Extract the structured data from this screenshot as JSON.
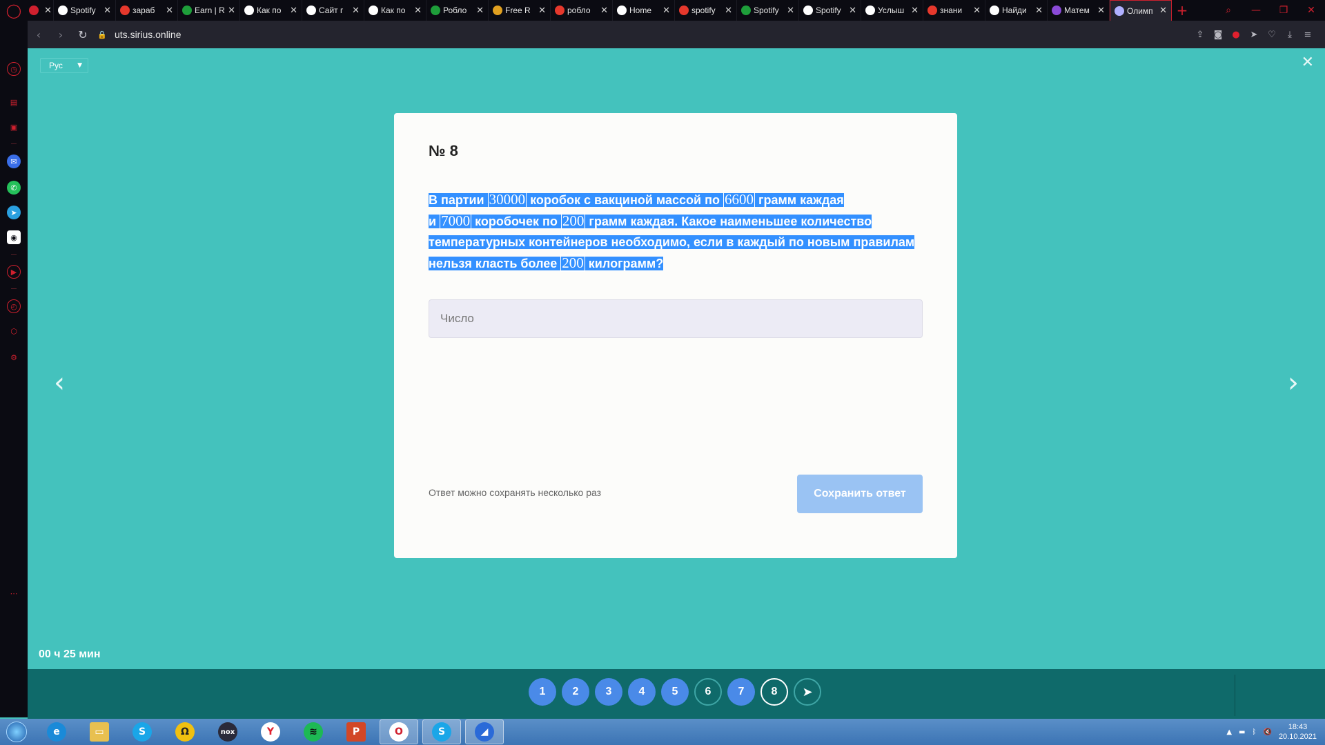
{
  "browser": {
    "tabs": [
      {
        "label": "",
        "favicon_color": "#d0202e",
        "favicon": "game-icon"
      },
      {
        "label": "Spotify",
        "favicon_color": "#ffffff",
        "favicon": "spotify-icon"
      },
      {
        "label": "зараб",
        "favicon_color": "#e6382c",
        "favicon": "yandex-icon"
      },
      {
        "label": "Earn | R",
        "favicon_color": "#1e9e3a",
        "favicon": "earn-icon"
      },
      {
        "label": "Как по",
        "favicon_color": "#ffffff",
        "favicon": "link-icon"
      },
      {
        "label": "Сайт г",
        "favicon_color": "#ffffff",
        "favicon": "site-icon"
      },
      {
        "label": "Как по",
        "favicon_color": "#ffffff",
        "favicon": "roblox-icon"
      },
      {
        "label": "Робло",
        "favicon_color": "#1e9e3a",
        "favicon": "rs-icon"
      },
      {
        "label": "Free R",
        "favicon_color": "#e0a020",
        "favicon": "free-icon"
      },
      {
        "label": "робло",
        "favicon_color": "#e6382c",
        "favicon": "yandex-icon"
      },
      {
        "label": "Home",
        "favicon_color": "#ffffff",
        "favicon": "home-icon"
      },
      {
        "label": "spotify",
        "favicon_color": "#e6382c",
        "favicon": "yandex-icon"
      },
      {
        "label": "Spotify",
        "favicon_color": "#1e9e3a",
        "favicon": "spotify-icon"
      },
      {
        "label": "Spotify",
        "favicon_color": "#ffffff",
        "favicon": "spotify-icon"
      },
      {
        "label": "Услыш",
        "favicon_color": "#ffffff",
        "favicon": "spotify-icon"
      },
      {
        "label": "знани",
        "favicon_color": "#e6382c",
        "favicon": "yandex-icon"
      },
      {
        "label": "Найди",
        "favicon_color": "#ffffff",
        "favicon": "z-icon"
      },
      {
        "label": "Матем",
        "favicon_color": "#8a4ad8",
        "favicon": "math-icon"
      },
      {
        "label": "Олимп",
        "favicon_color": "#b0b0ff",
        "favicon": "sirius-icon"
      }
    ],
    "url": "uts.sirius.online"
  },
  "page": {
    "language": "Рус",
    "question_number": "№ 8",
    "question_parts": [
      "В партии ",
      "30000",
      " коробок с вакциной массой по ",
      "6600",
      " грамм каждая",
      "и ",
      "7000",
      " коробочек по ",
      "200",
      " грамм каждая. Какое наименьшее количество",
      "температурных контейнеров необходимо, если в каждый по новым правилам",
      "нельзя класть более ",
      "200",
      " килограмм?"
    ],
    "answer_placeholder": "Число",
    "hint": "Ответ можно сохранять несколько раз",
    "save_label": "Сохранить ответ",
    "timer": "00 ч 25 мин",
    "nav": [
      "1",
      "2",
      "3",
      "4",
      "5",
      "6",
      "7",
      "8"
    ],
    "next_icon": "send-arrow-icon"
  },
  "taskbar": {
    "apps": [
      "edge",
      "explorer",
      "skype",
      "chat",
      "nox",
      "yandex",
      "spotify",
      "powerpoint",
      "opera",
      "skype-active",
      "app"
    ],
    "time": "18:43",
    "date": "20.10.2021"
  }
}
